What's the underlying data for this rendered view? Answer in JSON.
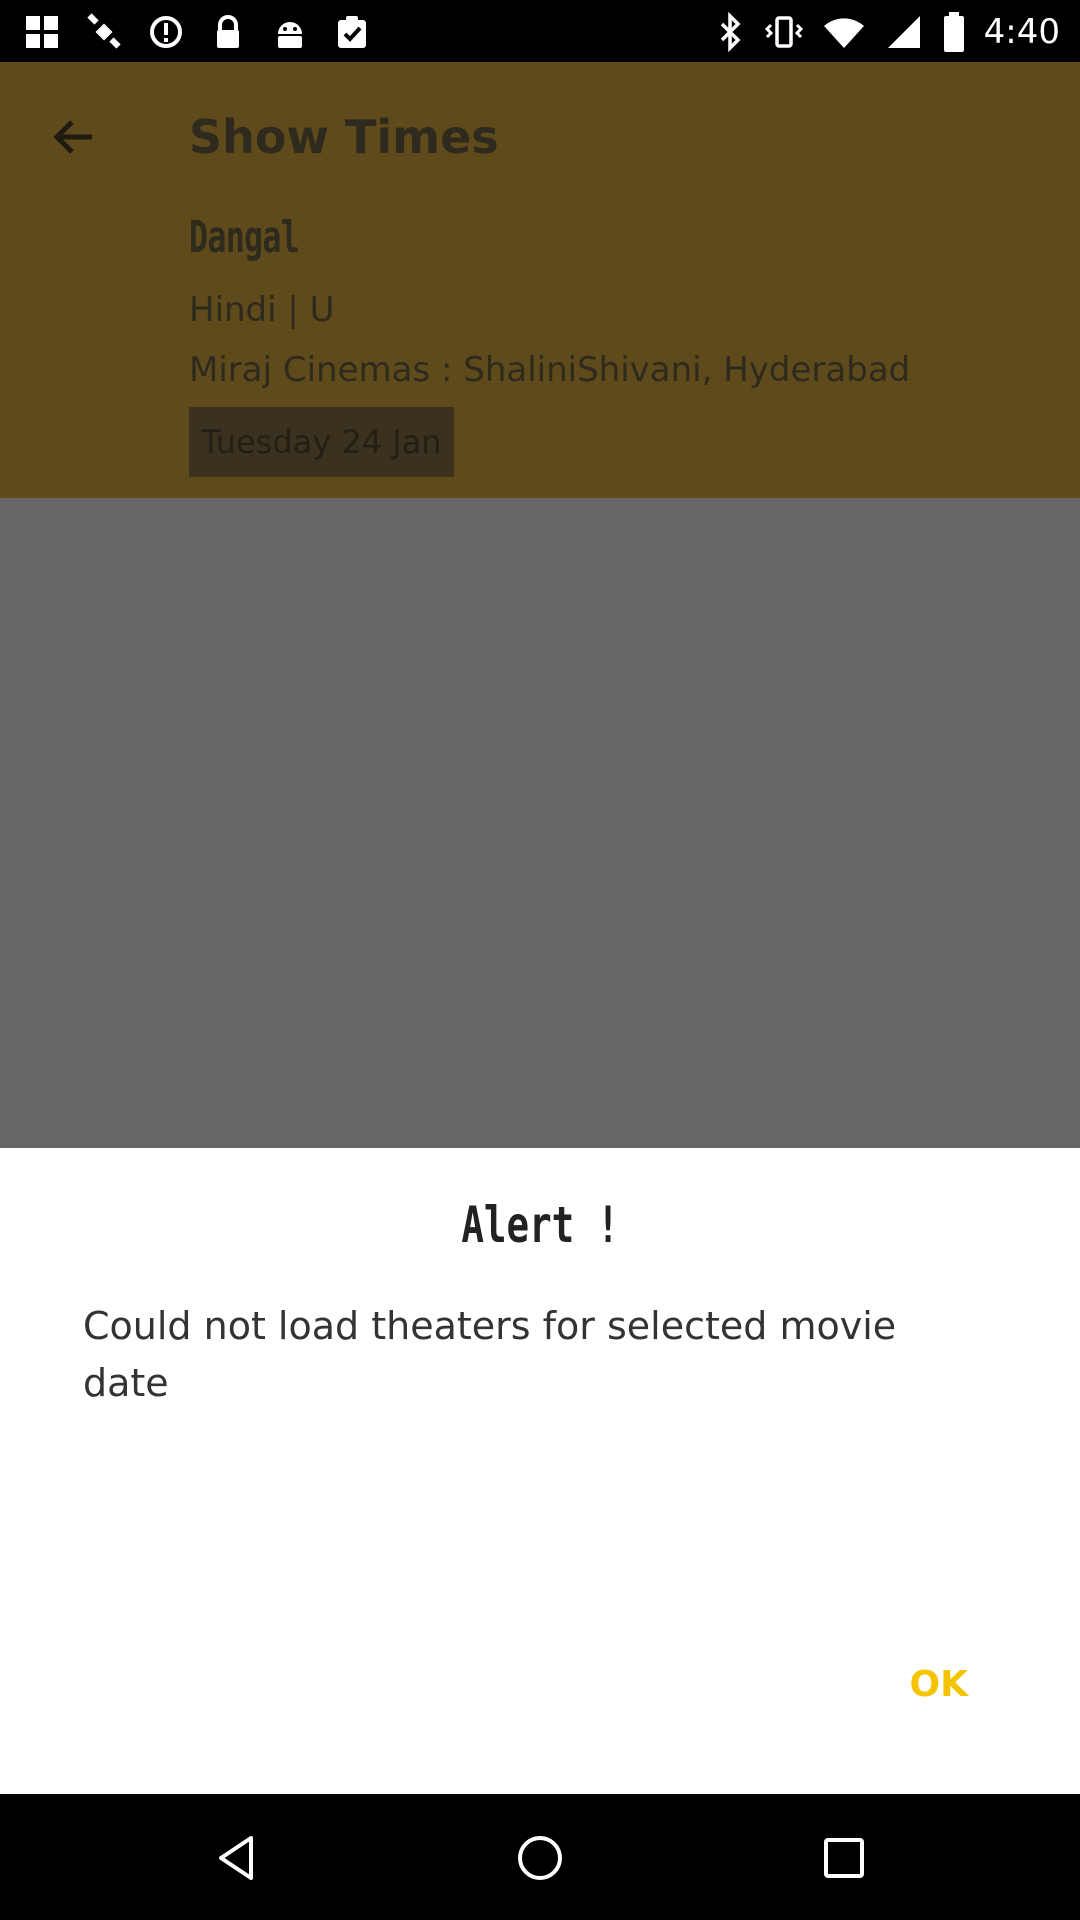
{
  "status_bar": {
    "time": "4:40",
    "icons_left": [
      "fake-gps-icon",
      "satellite-icon",
      "sync-icon",
      "lock-icon",
      "android-icon",
      "clipboard-check-icon"
    ],
    "icons_right": [
      "bluetooth-icon",
      "vibrate-icon",
      "wifi-icon",
      "signal-icon",
      "battery-icon"
    ]
  },
  "header": {
    "title": "Show Times",
    "movie_name": "Dangal",
    "movie_meta": "Hindi | U",
    "cinema": "Miraj Cinemas : ShaliniShivani, Hyderabad",
    "date_chip": "Tuesday 24 Jan"
  },
  "dialog": {
    "title": "Alert !",
    "message": "Could not load theaters for selected movie date",
    "ok_label": "OK"
  },
  "colors": {
    "header_dimmed": "#5e4a1a",
    "overlay": "#666666",
    "accent_ok": "#f5c400",
    "dialog_bg": "#ffffff"
  }
}
